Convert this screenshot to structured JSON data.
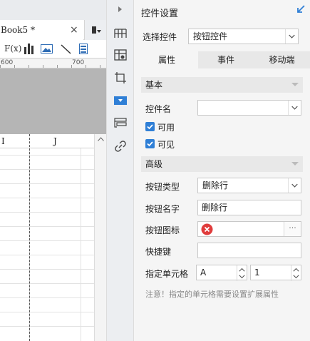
{
  "document": {
    "tab_title": "Book5 *",
    "close_glyph": "×",
    "formula_label": "F(x)"
  },
  "ruler": {
    "mark_a": "600",
    "mark_b": "700"
  },
  "sheet": {
    "columns": [
      "I",
      "J"
    ]
  },
  "panel": {
    "title": "控件设置",
    "select_widget_label": "选择控件",
    "select_widget_value": "按钮控件",
    "tabs": [
      "属性",
      "事件",
      "移动端"
    ],
    "section_basic": "基本",
    "widget_name_label": "控件名",
    "widget_name_value": "",
    "enabled_label": "可用",
    "enabled_checked": true,
    "visible_label": "可见",
    "visible_checked": true,
    "section_advanced": "高级",
    "button_type_label": "按钮类型",
    "button_type_value": "删除行",
    "button_name_label": "按钮名字",
    "button_name_value": "删除行",
    "button_icon_label": "按钮图标",
    "button_icon_more": "···",
    "shortcut_label": "快捷键",
    "shortcut_value": "",
    "target_cell_label": "指定单元格",
    "target_cell_column": "A",
    "target_cell_row": "1",
    "note": "注意！指定的单元格需要设置扩展属性"
  },
  "colors": {
    "accent_blue": "#2f7fd6",
    "delete_red": "#e03c3c",
    "panel_bg": "#f5f5f5",
    "sheet_gray": "#b5b5b5"
  },
  "icons": {
    "chart": "bar-chart-icon",
    "image": "image-icon",
    "line": "slash-line-icon",
    "delete": "delete-circle-icon"
  }
}
